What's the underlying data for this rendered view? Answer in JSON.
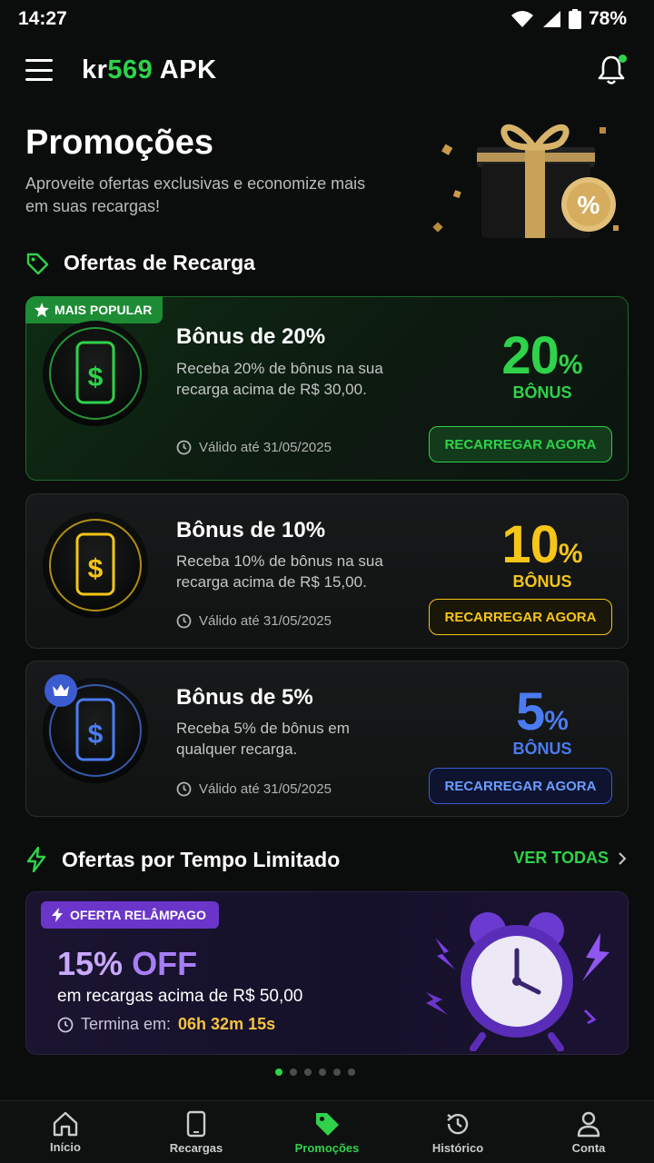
{
  "status": {
    "time": "14:27",
    "battery": "78%"
  },
  "header": {
    "brand_prefix": "kr",
    "brand_number": "569",
    "brand_suffix": " APK"
  },
  "hero": {
    "title": "Promoções",
    "subtitle": "Aproveite ofertas exclusivas e economize mais em suas recargas!"
  },
  "recharge_section": {
    "title": "Ofertas de Recarga"
  },
  "offers": [
    {
      "badge": "MAIS POPULAR",
      "title": "Bônus de 20%",
      "desc": "Receba 20% de bônus na sua recarga acima de R$ 30,00.",
      "valid": "Válido até 31/05/2025",
      "pct": "20",
      "pct_symbol": "%",
      "bonus_label": "BÔNUS",
      "button": "RECARREGAR AGORA",
      "color": "#2fd24a"
    },
    {
      "title": "Bônus de 10%",
      "desc": "Receba 10% de bônus na sua recarga acima de R$ 15,00.",
      "valid": "Válido até 31/05/2025",
      "pct": "10",
      "pct_symbol": "%",
      "bonus_label": "BÔNUS",
      "button": "RECARREGAR AGORA",
      "color": "#f5c518"
    },
    {
      "title": "Bônus de 5%",
      "desc": "Receba 5% de bônus em qualquer recarga.",
      "valid": "Válido até 31/05/2025",
      "pct": "5",
      "pct_symbol": "%",
      "bonus_label": "BÔNUS",
      "button": "RECARREGAR AGORA",
      "color": "#4a7bf0"
    }
  ],
  "limited_section": {
    "title": "Ofertas por Tempo Limitado",
    "see_all": "VER TODAS"
  },
  "flash": {
    "badge": "OFERTA RELÂMPAGO",
    "pct": "15%",
    "off": "OFF",
    "desc": "em recargas acima de R$ 50,00",
    "timer_label": "Termina em:",
    "timer_value": "06h 32m 15s"
  },
  "carousel": {
    "count": 6,
    "active": 0
  },
  "nav": [
    {
      "label": "Início",
      "icon": "home-icon"
    },
    {
      "label": "Recargas",
      "icon": "phone-icon"
    },
    {
      "label": "Promoções",
      "icon": "tag-icon",
      "active": true
    },
    {
      "label": "Histórico",
      "icon": "history-icon"
    },
    {
      "label": "Conta",
      "icon": "user-icon"
    }
  ]
}
